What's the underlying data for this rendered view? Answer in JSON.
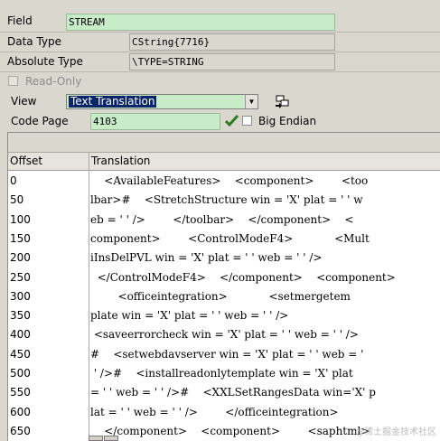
{
  "attributes": [
    {
      "label": "Field",
      "value": "STREAM"
    },
    {
      "label": "Data Type",
      "value": "CString{7716}"
    },
    {
      "label": "Absolute Type",
      "value": "\\TYPE=STRING"
    }
  ],
  "read_only_label": "Read-Only",
  "view": {
    "label": "View",
    "selected": "Text Translation"
  },
  "code_page": {
    "label": "Code Page",
    "value": "4103",
    "big_endian_label": "Big Endian"
  },
  "grid": {
    "headers": [
      "Offset",
      "Translation"
    ],
    "rows": [
      {
        "offset": "0",
        "text": "    <AvailableFeatures>    <component>        <too"
      },
      {
        "offset": "50",
        "text": "lbar>#    <StretchStructure win = 'X' plat = ' ' w"
      },
      {
        "offset": "100",
        "text": "eb = ' ' />        </toolbar>    </component>    <"
      },
      {
        "offset": "150",
        "text": "component>        <ControlModeF4>            <Mult"
      },
      {
        "offset": "200",
        "text": "iInsDelPVL win = 'X' plat = ' ' web = ' ' />"
      },
      {
        "offset": "250",
        "text": "  </ControlModeF4>    </component>    <component>"
      },
      {
        "offset": "300",
        "text": "        <officeintegration>            <setmergetem"
      },
      {
        "offset": "350",
        "text": "plate win = 'X' plat = ' ' web = ' ' />"
      },
      {
        "offset": "400",
        "text": " <saveerrorcheck win = 'X' plat = ' ' web = ' ' />"
      },
      {
        "offset": "450",
        "text": "#    <setwebdavserver win = 'X' plat = ' ' web = '"
      },
      {
        "offset": "500",
        "text": " ' />#    <installreadonlytemplate win = 'X' plat"
      },
      {
        "offset": "550",
        "text": "= ' ' web = ' ' />#    <XXLSetRangesData win='X' p"
      },
      {
        "offset": "600",
        "text": "lat = ' ' web = ' ' />        </officeintegration>"
      },
      {
        "offset": "650",
        "text": "    </component>    <component>        <saphtml>"
      }
    ]
  },
  "watermark": "@稀土掘金技术社区",
  "colors": {
    "field_green": "#c8ebc8",
    "selection": "#0a246a",
    "background": "#d9d7ce"
  }
}
